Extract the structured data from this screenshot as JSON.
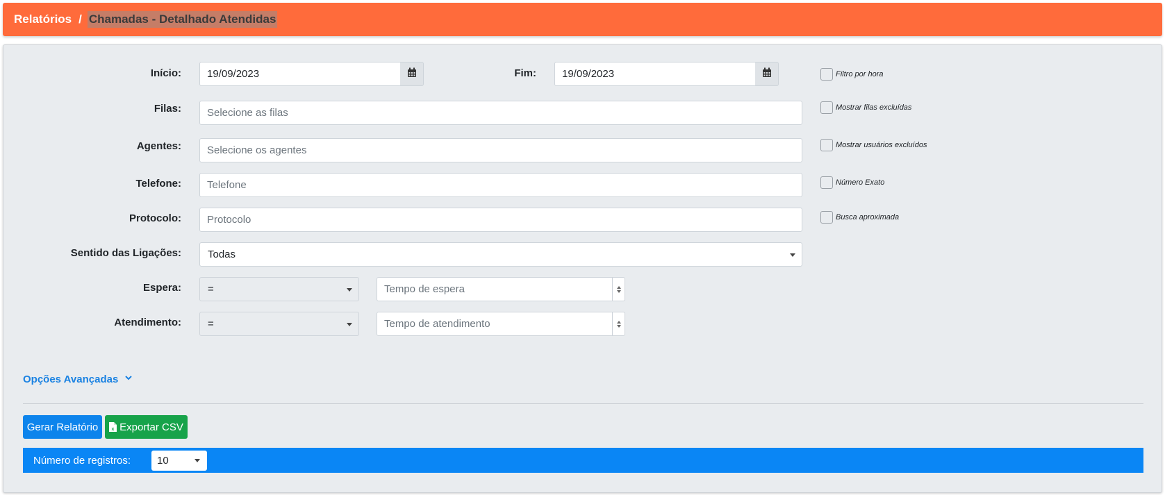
{
  "breadcrumb": {
    "root": "Relatórios",
    "separator": "/",
    "current": "Chamadas - Detalhado Atendidas"
  },
  "form": {
    "inicio": {
      "label": "Início:",
      "value": "19/09/2023"
    },
    "fim": {
      "label": "Fim:",
      "value": "19/09/2023"
    },
    "filas": {
      "label": "Filas:",
      "placeholder": "Selecione as filas"
    },
    "agentes": {
      "label": "Agentes:",
      "placeholder": "Selecione os agentes"
    },
    "telefone": {
      "label": "Telefone:",
      "placeholder": "Telefone"
    },
    "protocolo": {
      "label": "Protocolo:",
      "placeholder": "Protocolo"
    },
    "sentido": {
      "label": "Sentido das Ligações:",
      "value": "Todas"
    },
    "espera": {
      "label": "Espera:",
      "operator": "=",
      "placeholder": "Tempo de espera"
    },
    "atendimento": {
      "label": "Atendimento:",
      "operator": "=",
      "placeholder": "Tempo de atendimento"
    }
  },
  "checkboxes": {
    "filtro_hora": "Filtro por hora",
    "filas_excluidas": "Mostrar filas excluídas",
    "usuarios_excluidos": "Mostrar usuários excluídos",
    "numero_exato": "Número Exato",
    "busca_aproximada": "Busca aproximada"
  },
  "advanced": {
    "label": "Opções Avançadas"
  },
  "actions": {
    "gerar": "Gerar Relatório",
    "exportar": "Exportar CSV"
  },
  "records": {
    "label": "Número de registros:",
    "value": "10"
  },
  "colors": {
    "header": "#ff6b3b",
    "primary": "#0d84ec",
    "success": "#17a34a",
    "bar": "#0a86f5"
  },
  "icons": {
    "calendar": "calendar-icon",
    "csv": "file-excel-icon",
    "chevron": "chevron-down-icon"
  }
}
